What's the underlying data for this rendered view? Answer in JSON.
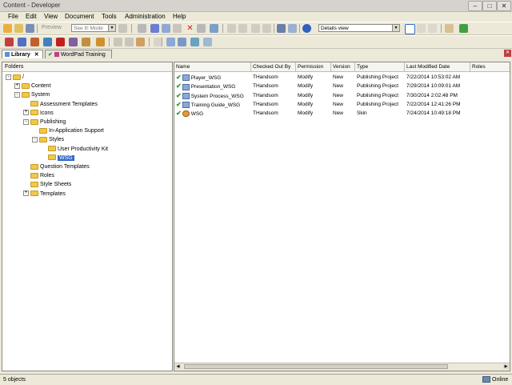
{
  "window": {
    "title": "Content - Developer",
    "minimize": "–",
    "maximize": "□",
    "close": "✕"
  },
  "menu": [
    "File",
    "Edit",
    "View",
    "Document",
    "Tools",
    "Administration",
    "Help"
  ],
  "toolbar": {
    "preview_label": "Preview",
    "mode_value": "See It! Mode",
    "view_value": "Details view"
  },
  "tabs": [
    {
      "label": "Library",
      "close": "✕"
    },
    {
      "label": "WordPad Training"
    }
  ],
  "tab_close_all": "✕",
  "folders": {
    "header": "Folders",
    "tree": [
      {
        "label": "/",
        "level": 0,
        "exp": "-"
      },
      {
        "label": "Content",
        "level": 1,
        "exp": "+"
      },
      {
        "label": "System",
        "level": 1,
        "exp": "-"
      },
      {
        "label": "Assessment Templates",
        "level": 2,
        "exp": ""
      },
      {
        "label": "Icons",
        "level": 2,
        "exp": "+"
      },
      {
        "label": "Publishing",
        "level": 2,
        "exp": "-"
      },
      {
        "label": "In-Application Support",
        "level": 3,
        "exp": ""
      },
      {
        "label": "Styles",
        "level": 3,
        "exp": "-"
      },
      {
        "label": "User Productivity Kit",
        "level": 4,
        "exp": ""
      },
      {
        "label": "WSG",
        "level": 4,
        "exp": "",
        "selected": true
      },
      {
        "label": "Question Templates",
        "level": 2,
        "exp": ""
      },
      {
        "label": "Roles",
        "level": 2,
        "exp": ""
      },
      {
        "label": "Style Sheets",
        "level": 2,
        "exp": ""
      },
      {
        "label": "Templates",
        "level": 2,
        "exp": "+"
      }
    ]
  },
  "grid": {
    "columns": [
      "Name",
      "Checked Out By",
      "Permission",
      "Version",
      "Type",
      "Last Modified Date",
      "Roles"
    ],
    "rows": [
      {
        "name": "Player_WSG",
        "checked_out_by": "THandsom",
        "permission": "Modify",
        "version": "New",
        "type": "Publishing Project",
        "modified": "7/22/2014 10:53:02 AM",
        "roles": "",
        "icon": "doc"
      },
      {
        "name": "Presentation_WSG",
        "checked_out_by": "THandsom",
        "permission": "Modify",
        "version": "New",
        "type": "Publishing Project",
        "modified": "7/29/2014 10:09:01 AM",
        "roles": "",
        "icon": "doc"
      },
      {
        "name": "System Process_WSG",
        "checked_out_by": "THandsom",
        "permission": "Modify",
        "version": "New",
        "type": "Publishing Project",
        "modified": "7/30/2014 2:02:48 PM",
        "roles": "",
        "icon": "doc"
      },
      {
        "name": "Training Guide_WSG",
        "checked_out_by": "THandsom",
        "permission": "Modify",
        "version": "New",
        "type": "Publishing Project",
        "modified": "7/22/2014 12:41:26 PM",
        "roles": "",
        "icon": "doc"
      },
      {
        "name": "WSG",
        "checked_out_by": "THandsom",
        "permission": "Modify",
        "version": "New",
        "type": "Skin",
        "modified": "7/24/2014 10:49:18 PM",
        "roles": "",
        "icon": "skin"
      }
    ],
    "check_glyph": "✔"
  },
  "status": {
    "count": "5 objects",
    "connection": "Online"
  },
  "colors": {
    "accent": "#316ac5",
    "folder": "#f0c94a",
    "check": "#2a9a2a"
  }
}
